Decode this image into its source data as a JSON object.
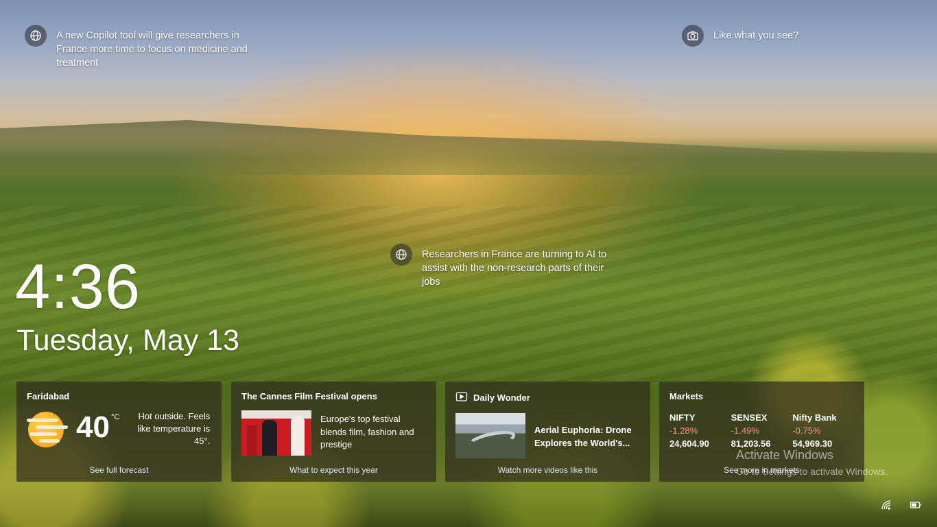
{
  "spotlight": {
    "top_left": {
      "icon": "globe-icon",
      "text": "A new Copilot tool will give researchers in France more time to focus on medicine and treatment"
    },
    "top_right": {
      "icon": "camera-icon",
      "text": "Like what you see?"
    },
    "center": {
      "icon": "globe-icon",
      "text": "Researchers in France are turning to AI to assist with the non-research parts of their jobs"
    }
  },
  "clock": {
    "time": "4:36",
    "date": "Tuesday, May 13"
  },
  "cards": {
    "weather": {
      "location": "Faridabad",
      "icon": "hazy-sun-icon",
      "temperature": "40",
      "unit": "°C",
      "description": "Hot outside. Feels like temperature is 45°.",
      "link": "See full forecast"
    },
    "news": {
      "title": "The Cannes Film Festival opens",
      "summary": "Europe's top festival blends film, fashion and prestige",
      "link": "What to expect this year"
    },
    "wonder": {
      "title": "Daily Wonder",
      "icon": "video-icon",
      "headline": "Aerial Euphoria: Drone Explores the World's...",
      "link": "Watch more videos like this"
    },
    "markets": {
      "title": "Markets",
      "items": [
        {
          "name": "NIFTY",
          "change": "-1.28%",
          "value": "24,604.90"
        },
        {
          "name": "SENSEX",
          "change": "-1.49%",
          "value": "81,203.56"
        },
        {
          "name": "Nifty Bank",
          "change": "-0.75%",
          "value": "54,969.30"
        }
      ],
      "link": "See more in markets"
    }
  },
  "watermark": {
    "line1": "Activate Windows",
    "line2": "Go to Settings to activate Windows."
  },
  "tray": {
    "network_icon": "wifi-icon",
    "battery_icon": "battery-icon"
  },
  "colors": {
    "negative_change": "#ff8f8f",
    "link": "#dbe6ff",
    "card_bg": "rgba(48,46,30,0.72)"
  }
}
